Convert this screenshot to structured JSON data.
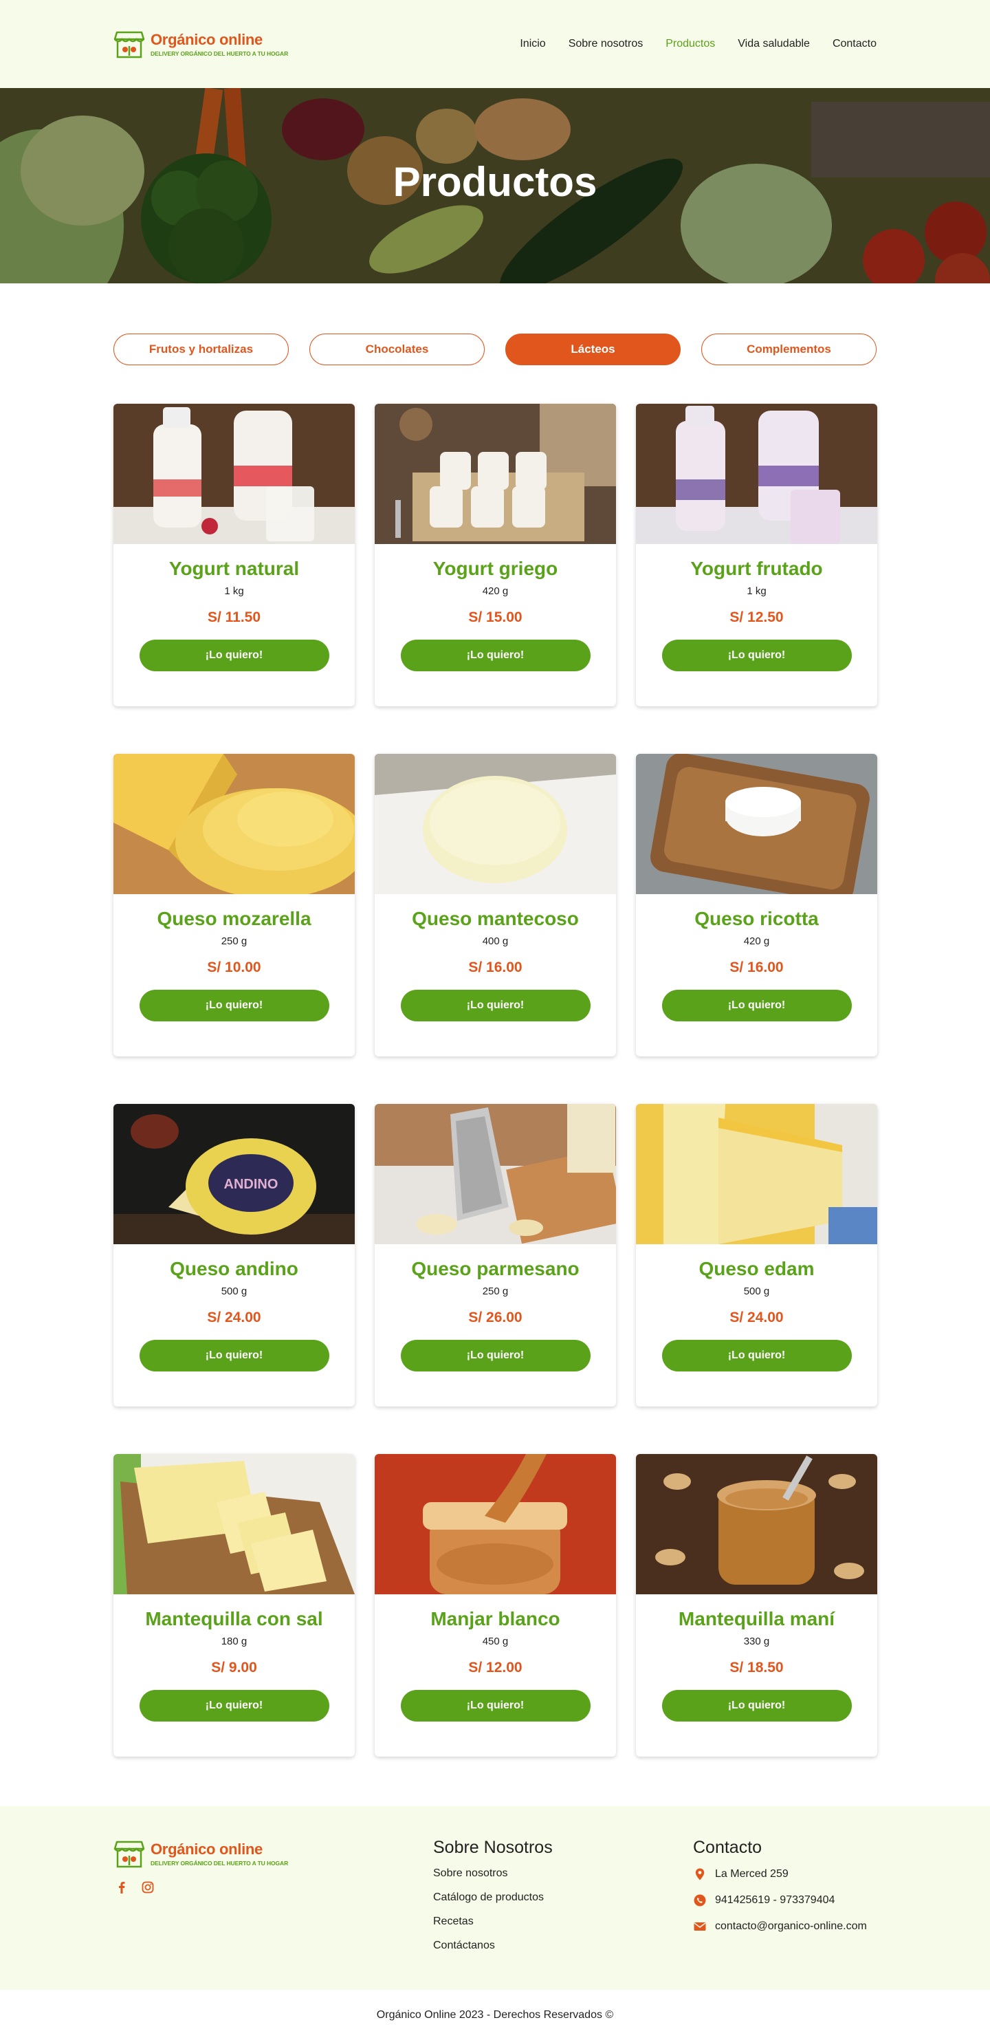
{
  "brand": {
    "name": "Orgánico online",
    "tagline": "DELIVERY ORGÁNICO DEL HUERTO A TU HOGAR",
    "color_primary": "#e0561d",
    "color_secondary": "#5aa21a"
  },
  "nav": [
    {
      "label": "Inicio",
      "active": false
    },
    {
      "label": "Sobre nosotros",
      "active": false
    },
    {
      "label": "Productos",
      "active": true
    },
    {
      "label": "Vida saludable",
      "active": false
    },
    {
      "label": "Contacto",
      "active": false
    }
  ],
  "hero": {
    "title": "Productos"
  },
  "filters": [
    {
      "label": "Frutos y hortalizas",
      "active": false
    },
    {
      "label": "Chocolates",
      "active": false
    },
    {
      "label": "Lácteos",
      "active": true
    },
    {
      "label": "Complementos",
      "active": false
    }
  ],
  "products": [
    {
      "name": "Yogurt natural",
      "weight": "1 kg",
      "price": "S/ 11.50",
      "button": "¡Lo quiero!",
      "image": "yogurt-bottles"
    },
    {
      "name": "Yogurt griego",
      "weight": "420 g",
      "price": "S/ 15.00",
      "button": "¡Lo quiero!",
      "image": "yogurt-jars"
    },
    {
      "name": "Yogurt frutado",
      "weight": "1 kg",
      "price": "S/ 12.50",
      "button": "¡Lo quiero!",
      "image": "fruit-yogurt-bottles"
    },
    {
      "name": "Queso mozarella",
      "weight": "250 g",
      "price": "S/ 10.00",
      "button": "¡Lo quiero!",
      "image": "grated-cheese"
    },
    {
      "name": "Queso mantecoso",
      "weight": "400 g",
      "price": "S/ 16.00",
      "button": "¡Lo quiero!",
      "image": "soft-cheese"
    },
    {
      "name": "Queso ricotta",
      "weight": "420 g",
      "price": "S/ 16.00",
      "button": "¡Lo quiero!",
      "image": "ricotta-board"
    },
    {
      "name": "Queso andino",
      "weight": "500 g",
      "price": "S/ 24.00",
      "button": "¡Lo quiero!",
      "image": "andino-cheese",
      "label_text": "ANDINO"
    },
    {
      "name": "Queso parmesano",
      "weight": "250 g",
      "price": "S/ 26.00",
      "button": "¡Lo quiero!",
      "image": "parmesan-grater"
    },
    {
      "name": "Queso edam",
      "weight": "500 g",
      "price": "S/ 24.00",
      "button": "¡Lo quiero!",
      "image": "edam-wedge"
    },
    {
      "name": "Mantequilla con sal",
      "weight": "180 g",
      "price": "S/ 9.00",
      "button": "¡Lo quiero!",
      "image": "butter-block"
    },
    {
      "name": "Manjar blanco",
      "weight": "450 g",
      "price": "S/ 12.00",
      "button": "¡Lo quiero!",
      "image": "dulce-jar"
    },
    {
      "name": "Mantequilla maní",
      "weight": "330 g",
      "price": "S/ 18.50",
      "button": "¡Lo quiero!",
      "image": "peanut-butter-jar"
    }
  ],
  "footer": {
    "about_heading": "Sobre Nosotros",
    "about_links": [
      "Sobre nosotros",
      "Catálogo de productos",
      "Recetas",
      "Contáctanos"
    ],
    "contact_heading": "Contacto",
    "address": "La Merced 259",
    "phones": "941425619 - 973379404",
    "email": "contacto@organico-online.com",
    "socials": [
      "facebook-icon",
      "instagram-icon"
    ],
    "copyright": "Orgánico Online 2023 - Derechos Reservados ©"
  }
}
